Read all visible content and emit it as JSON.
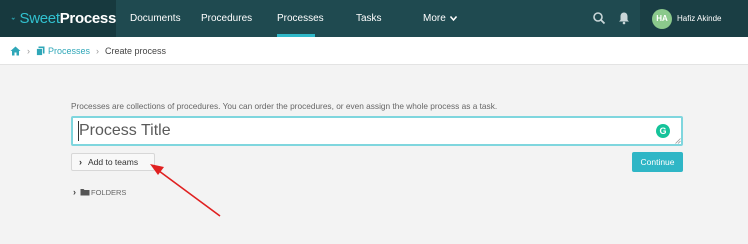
{
  "brand": {
    "part1": "Sweet",
    "part2": "Process"
  },
  "nav": {
    "items": [
      {
        "label": "Documents"
      },
      {
        "label": "Procedures"
      },
      {
        "label": "Processes"
      },
      {
        "label": "Tasks"
      },
      {
        "label": "More"
      }
    ],
    "active": "Processes",
    "icons": [
      "search-icon",
      "bell-icon",
      "chevron-down-icon"
    ]
  },
  "user": {
    "initials": "HA",
    "name": "Hafiz Akinde"
  },
  "breadcrumb": {
    "link": "Processes",
    "current": "Create process"
  },
  "form": {
    "description": "Processes are collections of procedures. You can order the procedures, or even assign the whole process as a task.",
    "title_placeholder": "Process Title",
    "add_teams_label": "Add to teams",
    "continue_label": "Continue",
    "folders_label": "FOLDERS"
  },
  "grammarly_badge": "G",
  "colors": {
    "nav_bg": "#1f4a50",
    "accent": "#2fb6c6",
    "annotation_arrow": "#e02020"
  }
}
